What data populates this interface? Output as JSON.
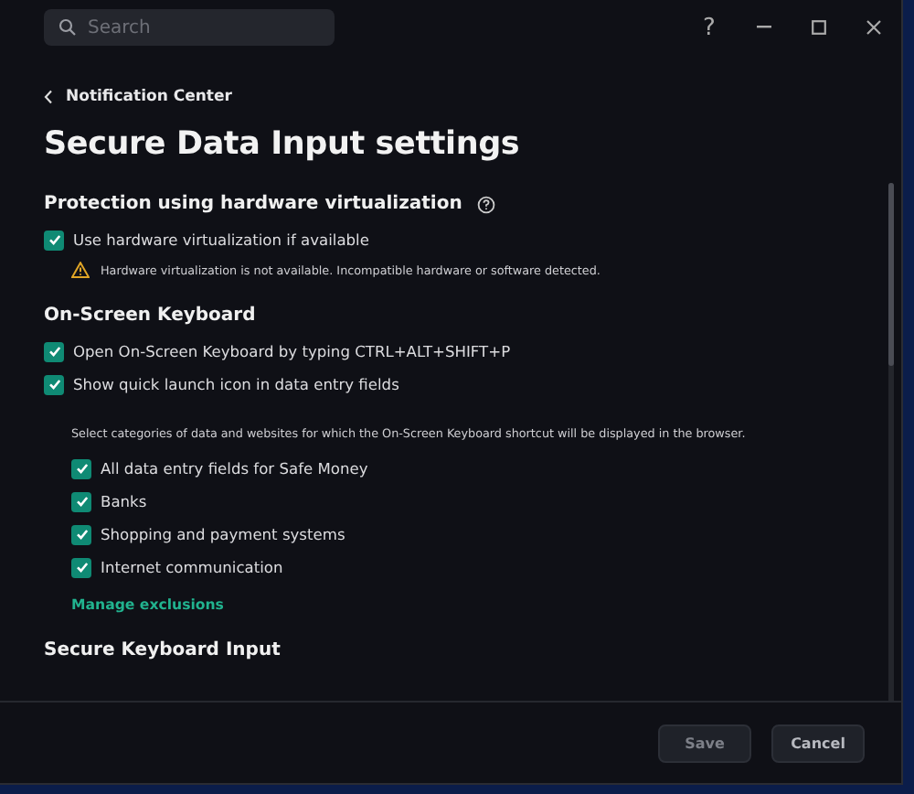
{
  "search": {
    "placeholder": "Search"
  },
  "window_controls": {
    "help": "?"
  },
  "back_link": "Notification Center",
  "title": "Secure Data Input settings",
  "sections": [
    {
      "heading": "Protection using hardware virtualization",
      "has_help": true,
      "items": [
        {
          "kind": "checkbox",
          "label": "Use hardware virtualization if available",
          "checked": true
        },
        {
          "kind": "warning",
          "text": "Hardware virtualization is not available. Incompatible hardware or software detected."
        }
      ]
    },
    {
      "heading": "On-Screen Keyboard",
      "items": [
        {
          "kind": "checkbox",
          "label": "Open On-Screen Keyboard by typing CTRL+ALT+SHIFT+P",
          "checked": true
        },
        {
          "kind": "checkbox",
          "label": "Show quick launch icon in data entry fields",
          "checked": true
        },
        {
          "kind": "note",
          "text": "Select categories of data and websites for which the On-Screen Keyboard shortcut will be displayed in the browser."
        },
        {
          "kind": "subcheckbox",
          "label": "All data entry fields for Safe Money",
          "checked": true
        },
        {
          "kind": "subcheckbox",
          "label": "Banks",
          "checked": true
        },
        {
          "kind": "subcheckbox",
          "label": "Shopping and payment systems",
          "checked": true
        },
        {
          "kind": "subcheckbox",
          "label": "Internet communication",
          "checked": true
        },
        {
          "kind": "link",
          "text": "Manage exclusions"
        }
      ]
    },
    {
      "heading": "Secure Keyboard Input"
    }
  ],
  "buttons": [
    {
      "label": "Save",
      "disabled": true
    },
    {
      "label": "Cancel",
      "disabled": false
    }
  ]
}
